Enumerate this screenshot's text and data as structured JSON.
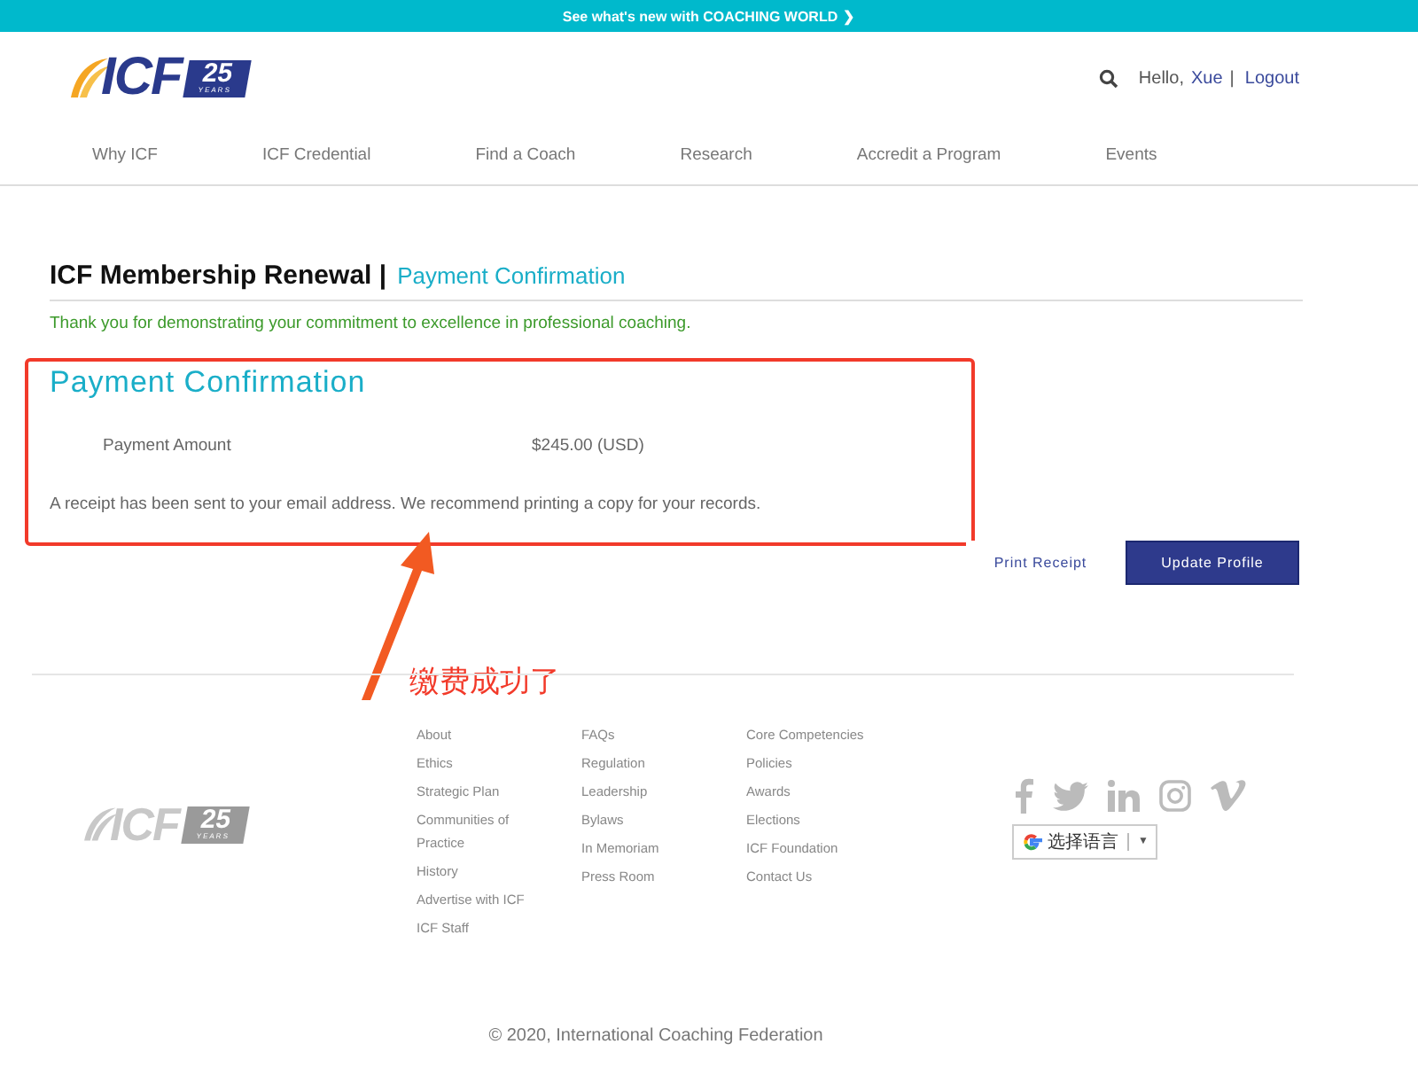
{
  "banner": {
    "text": "See what's new with COACHING WORLD",
    "chevron": "❯"
  },
  "logo": {
    "letters": "ICF",
    "number": "25",
    "years": "YEARS"
  },
  "header": {
    "greeting": "Hello,",
    "user": "Xue",
    "separator": "|",
    "logout": "Logout"
  },
  "nav": [
    "Why ICF",
    "ICF Credential",
    "Find a Coach",
    "Research",
    "Accredit a Program",
    "Events"
  ],
  "page": {
    "title": "ICF Membership Renewal |",
    "subtitle": "Payment Confirmation",
    "thanks": "Thank you for demonstrating your commitment to excellence in professional coaching."
  },
  "confirmation": {
    "heading": "Payment Confirmation",
    "label": "Payment Amount",
    "amount": "$245.00 (USD)",
    "note": "A receipt has been sent to your email address. We recommend printing a copy for your records."
  },
  "buttons": [
    {
      "label": "Print Receipt",
      "kind": "link"
    },
    {
      "label": "Update Profile",
      "kind": "primary"
    }
  ],
  "annotation": {
    "text": "缴费成功了"
  },
  "footer_logo": {
    "letters": "ICF",
    "number": "25",
    "years": "YEARS"
  },
  "footer": {
    "columns": [
      [
        "About",
        "Ethics",
        "Strategic Plan",
        "Communities of Practice",
        "History",
        "Advertise with ICF",
        "ICF Staff"
      ],
      [
        "FAQs",
        "Regulation",
        "Leadership",
        "Bylaws",
        "In Memoriam",
        "Press Room"
      ],
      [
        "Core Competencies",
        "Policies",
        "Awards",
        "Elections",
        "ICF Foundation",
        "Contact Us"
      ]
    ],
    "language": {
      "label": "选择语言",
      "caret": "▼"
    },
    "copyright": "© 2020, International Coaching Federation"
  }
}
